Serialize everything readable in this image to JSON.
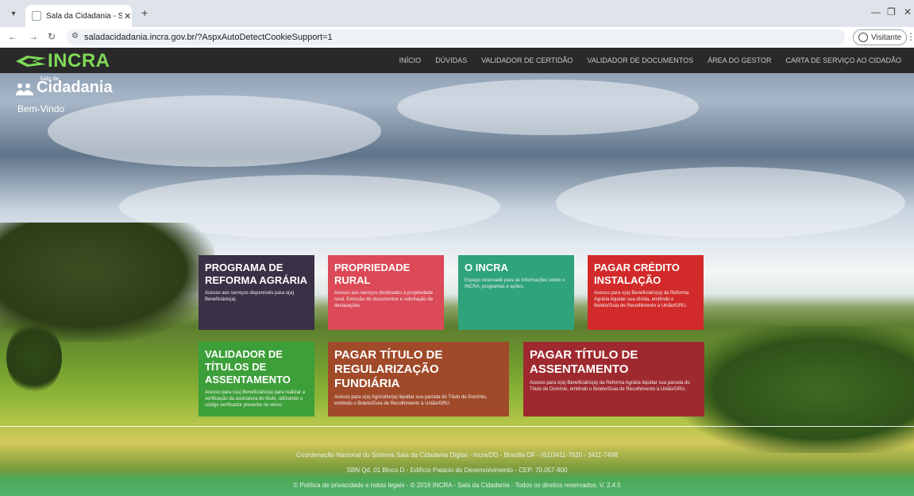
{
  "browser": {
    "tab_title": "Sala da Cidadania - Sala da Cid...",
    "url": "saladacidadania.incra.gov.br/?AspxAutoDetectCookieSupport=1",
    "guest_label": "Visitante"
  },
  "nav": {
    "logo_text": "INCRA",
    "menu": [
      "INÍCIO",
      "DÚVIDAS",
      "VALIDADOR DE CERTIDÃO",
      "VALIDADOR DE DOCUMENTOS",
      "ÁREA DO GESTOR",
      "CARTA DE SERVIÇO AO CIDADÃO"
    ]
  },
  "brand": {
    "small": "Sala da",
    "name": "Cidadania",
    "welcome": "Bem-Vindo"
  },
  "tiles": [
    {
      "title": "PROGRAMA DE REFORMA AGRÁRIA",
      "desc": "Acesso aos serviços disponíveis para o(a) Beneficiário(a).",
      "color": "#3a3146"
    },
    {
      "title": "PROPRIEDADE RURAL",
      "desc": "Acesso aos serviços destinados à propriedade rural. Emissão de documentos e solicitação de declarações.",
      "color": "#db4a56"
    },
    {
      "title": "O INCRA",
      "desc": "Espaço reservado para as informações sobre o INCRA, programas e ações.",
      "color": "#2ea37c"
    },
    {
      "title": "PAGAR CRÉDITO INSTALAÇÃO",
      "desc": "Acesso para o(a) Beneficiário(a) da Reforma Agrária liquidar sua dívida, emitindo o Boleto/Guia de Recolhimento à União/GRU.",
      "color": "#d22a2a"
    },
    {
      "title": "VALIDADOR DE TÍTULOS DE ASSENTAMENTO",
      "desc": "Acesso para o(a) Beneficiário(a) para realizar a verificação da assinatura do título, utilizando o código verificador presente no verso.",
      "color": "#3d9f39"
    },
    {
      "title": "PAGAR TÍTULO DE REGULARIZAÇÃO FUNDIÁRIA",
      "desc": "Acesso para o(a) Agricultor(a) liquidar sua parcela do Título de Domínio, emitindo o Boleto/Guia de Recolhimento à União/GRU.",
      "color": "#a04a2a"
    },
    {
      "title": "PAGAR TÍTULO DE ASSENTAMENTO",
      "desc": "Acesso para o(a) Beneficiário(a) da Reforma Agrária liquidar sua parcela do Título de Domínio, emitindo o Boleto/Guia de Recolhimento à União/GRU.",
      "color": "#9e2a2f"
    }
  ],
  "footer": {
    "line1": "Coordenação Nacional do Sistema Sala da Cidadania Digital - Incra/DD - Brasília DF - (61)3411-7620 - 3411-7498",
    "line2": "SBN Qd. 01 Bloco D - Edifício Palácio do Desenvolvimento - CEP: 70.057-900",
    "line3": "© Política de privacidade e notas legais - © 2016 INCRA - Sala da Cidadania - Todos os direitos reservados. V. 2.4.5"
  }
}
